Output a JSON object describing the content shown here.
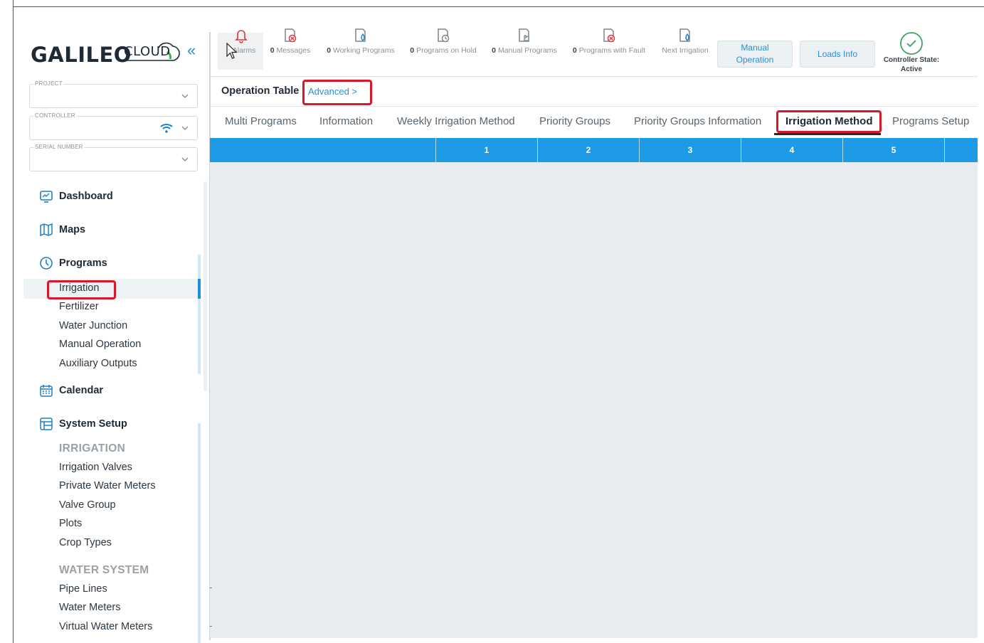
{
  "brand": {
    "name": "GALILEO",
    "suffix": "CLOUD",
    "collapse_icon": "double-chevron-left-icon"
  },
  "filters": {
    "project": {
      "label": "PROJECT",
      "value": ""
    },
    "controller": {
      "label": "CONTROLLER",
      "value": ""
    },
    "serial": {
      "label": "SERIAL NUMBER",
      "value": ""
    }
  },
  "nav": {
    "dashboard": "Dashboard",
    "maps": "Maps",
    "programs": {
      "label": "Programs",
      "items": [
        "Irrigation",
        "Fertilizer",
        "Water Junction",
        "Manual Operation",
        "Auxiliary Outputs"
      ],
      "active": "Irrigation"
    },
    "calendar": "Calendar",
    "system_setup": {
      "label": "System Setup",
      "irrigation_section": "IRRIGATION",
      "irrigation_items": [
        "Irrigation Valves",
        "Private Water Meters",
        "Valve Group",
        "Plots",
        "Crop Types"
      ],
      "water_section": "WATER SYSTEM",
      "water_items": [
        "Pipe Lines",
        "Water Meters",
        "Virtual Water Meters"
      ]
    }
  },
  "toolbar": {
    "stats": [
      {
        "count": "0",
        "label": "Alarms",
        "icon": "bell-icon"
      },
      {
        "count": "0",
        "label": "Messages",
        "icon": "message-x-icon"
      },
      {
        "count": "0",
        "label": "Working Programs",
        "icon": "drop-icon"
      },
      {
        "count": "0",
        "label": "Programs on Hold",
        "icon": "clock-icon"
      },
      {
        "count": "0",
        "label": "Manual Programs",
        "icon": "hand-icon"
      },
      {
        "count": "0",
        "label": "Programs with Fault",
        "icon": "fault-icon"
      },
      {
        "count": "",
        "label": "Next Irrigation",
        "icon": "next-drop-icon"
      }
    ],
    "manual_operation": "Manual\nOperation",
    "loads_info": "Loads Info",
    "controller_state_label": "Controller State:",
    "controller_state_value": "Active"
  },
  "operation": {
    "title": "Operation Table",
    "advanced": "Advanced >"
  },
  "tabs": [
    "Multi Programs",
    "Information",
    "Weekly Irrigation Method",
    "Priority Groups",
    "Priority Groups Information",
    "Irrigation Method",
    "Programs Setup"
  ],
  "active_tab": "Irrigation Method",
  "table": {
    "columns": [
      "",
      "1",
      "2",
      "3",
      "4",
      "5",
      ""
    ]
  },
  "colors": {
    "accent": "#1d9be6",
    "highlight": "#d8182a",
    "success": "#3aa55d"
  }
}
